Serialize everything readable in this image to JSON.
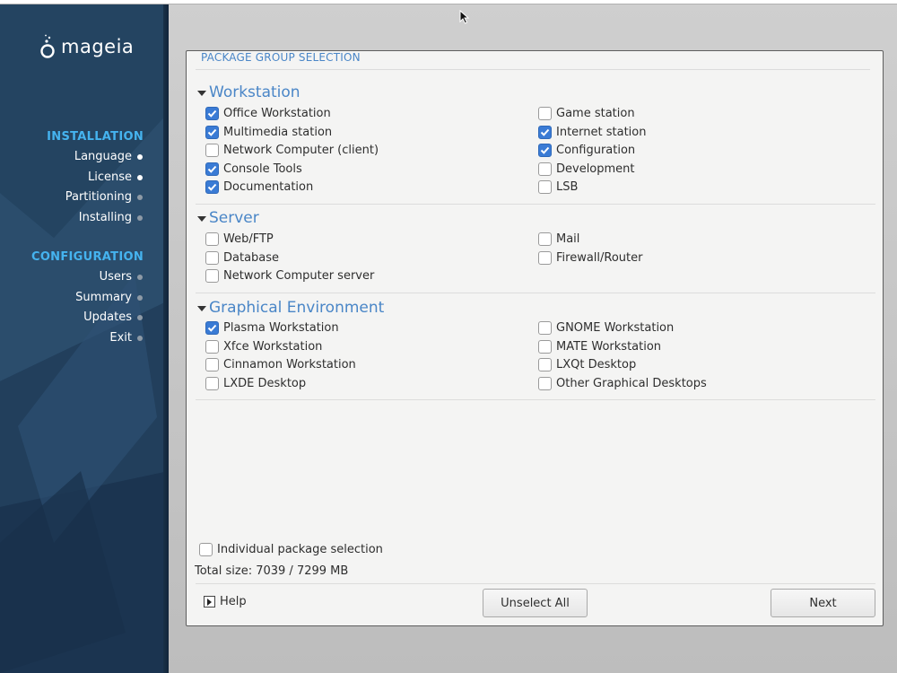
{
  "sidebar": {
    "logo_text": "mageia",
    "installation_heading": "INSTALLATION",
    "installation_items": [
      {
        "label": "Language",
        "done": true
      },
      {
        "label": "License",
        "done": true
      },
      {
        "label": "Partitioning",
        "done": false
      },
      {
        "label": "Installing",
        "done": false
      }
    ],
    "configuration_heading": "CONFIGURATION",
    "configuration_items": [
      {
        "label": "Users",
        "done": false
      },
      {
        "label": "Summary",
        "done": false
      },
      {
        "label": "Updates",
        "done": false
      },
      {
        "label": "Exit",
        "done": false
      }
    ]
  },
  "panel": {
    "title": "PACKAGE GROUP SELECTION",
    "groups": [
      {
        "name": "Workstation",
        "options": [
          {
            "label": "Office Workstation",
            "checked": true
          },
          {
            "label": "Game station",
            "checked": false
          },
          {
            "label": "Multimedia station",
            "checked": true
          },
          {
            "label": "Internet station",
            "checked": true
          },
          {
            "label": "Network Computer (client)",
            "checked": false
          },
          {
            "label": "Configuration",
            "checked": true
          },
          {
            "label": "Console Tools",
            "checked": true
          },
          {
            "label": "Development",
            "checked": false
          },
          {
            "label": "Documentation",
            "checked": true
          },
          {
            "label": "LSB",
            "checked": false
          }
        ]
      },
      {
        "name": "Server",
        "options": [
          {
            "label": "Web/FTP",
            "checked": false
          },
          {
            "label": "Mail",
            "checked": false
          },
          {
            "label": "Database",
            "checked": false
          },
          {
            "label": "Firewall/Router",
            "checked": false
          },
          {
            "label": "Network Computer server",
            "checked": false
          }
        ]
      },
      {
        "name": "Graphical Environment",
        "options": [
          {
            "label": "Plasma Workstation",
            "checked": true
          },
          {
            "label": "GNOME Workstation",
            "checked": false
          },
          {
            "label": "Xfce Workstation",
            "checked": false
          },
          {
            "label": "MATE Workstation",
            "checked": false
          },
          {
            "label": "Cinnamon Workstation",
            "checked": false
          },
          {
            "label": "LXQt Desktop",
            "checked": false
          },
          {
            "label": "LXDE Desktop",
            "checked": false
          },
          {
            "label": "Other Graphical Desktops",
            "checked": false
          }
        ]
      }
    ],
    "individual_selection": {
      "label": "Individual package selection",
      "checked": false
    },
    "total_size": "Total size: 7039 / 7299 MB",
    "help_label": "Help",
    "unselect_all_label": "Unselect All",
    "next_label": "Next"
  },
  "colors": {
    "accent": "#4a86c7",
    "checkbox_checked": "#3a7bd5",
    "sidebar_heading": "#45b3ef",
    "sidebar_bg": "#1f3a56"
  }
}
